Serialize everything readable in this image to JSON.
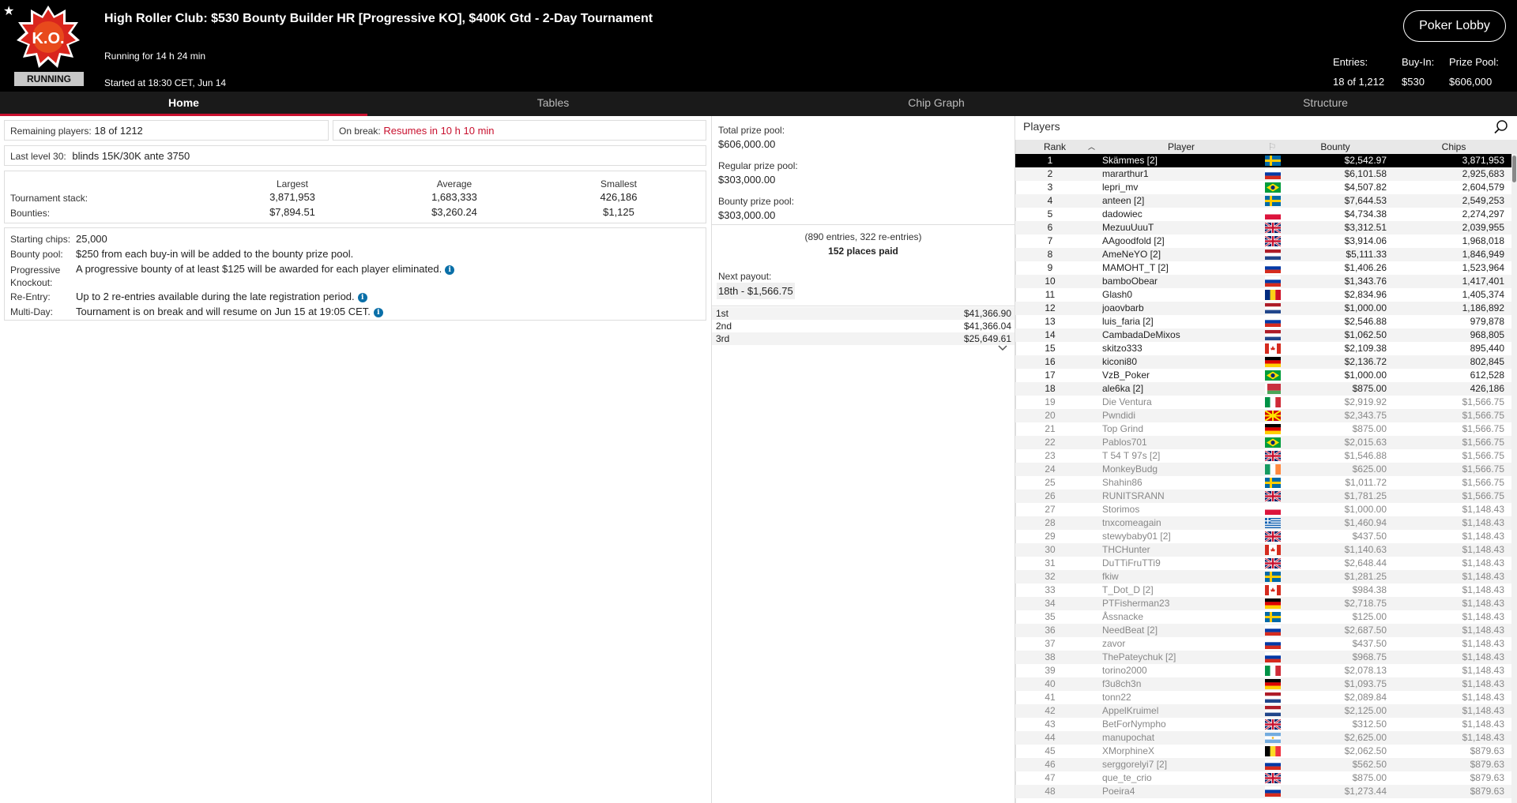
{
  "header": {
    "title": "High Roller Club: $530 Bounty Builder HR [Progressive KO], $400K Gtd - 2-Day Tournament",
    "running_for": "Running for 14 h 24 min",
    "started": "Started at 18:30 CET, Jun 14",
    "status_badge": "RUNNING",
    "logo_text": "K.O.",
    "lobby_button": "Poker Lobby",
    "entries_label": "Entries:",
    "entries_value": "18 of 1,212",
    "buyin_label": "Buy-In:",
    "buyin_value": "$530",
    "prizepool_label": "Prize Pool:",
    "prizepool_value": "$606,000"
  },
  "tabs": [
    "Home",
    "Tables",
    "Chip Graph",
    "Structure"
  ],
  "home": {
    "remaining_label": "Remaining players:",
    "remaining_value": "18 of 1212",
    "onbreak_label": "On break:",
    "onbreak_value": "Resumes in 10 h 10 min",
    "lastlevel_label": "Last level 30:",
    "lastlevel_value": "blinds 15K/30K ante 3750",
    "stack_headers": [
      "Largest",
      "Average",
      "Smallest"
    ],
    "stack_label": "Tournament stack:",
    "stack_values": [
      "3,871,953",
      "1,683,333",
      "426,186"
    ],
    "bounties_label": "Bounties:",
    "bounty_values": [
      "$7,894.51",
      "$3,260.24",
      "$1,125"
    ],
    "rules": [
      {
        "label": "Starting chips:",
        "text": "25,000"
      },
      {
        "label": "Bounty pool:",
        "text": "$250 from each buy-in will be added to the bounty prize pool."
      },
      {
        "label": "Progressive Knockout:",
        "text": "A progressive bounty of at least $125 will be awarded for each player eliminated."
      },
      {
        "label": "Re-Entry:",
        "text": "Up to 2 re-entries available during the late registration period."
      },
      {
        "label": "Multi-Day:",
        "text": "Tournament is on break and will resume on Jun 15 at 19:05 CET."
      }
    ]
  },
  "prize": {
    "total_label": "Total prize pool:",
    "total_value": "$606,000.00",
    "regular_label": "Regular prize pool:",
    "regular_value": "$303,000.00",
    "bounty_label": "Bounty prize pool:",
    "bounty_value": "$303,000.00",
    "entries_note": "(890 entries, 322 re-entries)",
    "places_paid": "152 places paid",
    "next_payout_label": "Next payout:",
    "next_payout_value": "18th - $1,566.75",
    "payouts": [
      {
        "place": "1st",
        "amount": "$41,366.90"
      },
      {
        "place": "2nd",
        "amount": "$41,366.04"
      },
      {
        "place": "3rd",
        "amount": "$25,649.61"
      }
    ]
  },
  "players": {
    "title": "Players",
    "columns": [
      "Rank",
      "Player",
      "Bounty",
      "Chips"
    ],
    "rows": [
      {
        "rank": "1",
        "name": "Skämmes [2]",
        "flag": "se",
        "bounty": "$2,542.97",
        "chips": "3,871,953"
      },
      {
        "rank": "2",
        "name": "mararthur1",
        "flag": "ru",
        "bounty": "$6,101.58",
        "chips": "2,925,683"
      },
      {
        "rank": "3",
        "name": "lepri_mv",
        "flag": "br",
        "bounty": "$4,507.82",
        "chips": "2,604,579"
      },
      {
        "rank": "4",
        "name": "anteen [2]",
        "flag": "se",
        "bounty": "$7,644.53",
        "chips": "2,549,253"
      },
      {
        "rank": "5",
        "name": "dadowiec",
        "flag": "pl",
        "bounty": "$4,734.38",
        "chips": "2,274,297"
      },
      {
        "rank": "6",
        "name": "MezuuUuuT",
        "flag": "gb",
        "bounty": "$3,312.51",
        "chips": "2,039,955"
      },
      {
        "rank": "7",
        "name": "AAgoodfold [2]",
        "flag": "gb",
        "bounty": "$3,914.06",
        "chips": "1,968,018"
      },
      {
        "rank": "8",
        "name": "AmeNeYO [2]",
        "flag": "nl",
        "bounty": "$5,111.33",
        "chips": "1,846,949"
      },
      {
        "rank": "9",
        "name": "MAMOHT_T [2]",
        "flag": "ru",
        "bounty": "$1,406.26",
        "chips": "1,523,964"
      },
      {
        "rank": "10",
        "name": "bamboObear",
        "flag": "ru",
        "bounty": "$1,343.76",
        "chips": "1,417,401"
      },
      {
        "rank": "11",
        "name": "Glash0",
        "flag": "ro",
        "bounty": "$2,834.96",
        "chips": "1,405,374"
      },
      {
        "rank": "12",
        "name": "joaovbarb",
        "flag": "nl",
        "bounty": "$1,000.00",
        "chips": "1,186,892"
      },
      {
        "rank": "13",
        "name": "luis_faria [2]",
        "flag": "ru",
        "bounty": "$2,546.88",
        "chips": "979,878"
      },
      {
        "rank": "14",
        "name": "CambadaDeMixos",
        "flag": "nl",
        "bounty": "$1,062.50",
        "chips": "968,805"
      },
      {
        "rank": "15",
        "name": "skitzo333",
        "flag": "ca",
        "bounty": "$2,109.38",
        "chips": "895,440"
      },
      {
        "rank": "16",
        "name": "kiconi80",
        "flag": "de",
        "bounty": "$2,136.72",
        "chips": "802,845"
      },
      {
        "rank": "17",
        "name": "VzB_Poker",
        "flag": "br",
        "bounty": "$1,000.00",
        "chips": "612,528"
      },
      {
        "rank": "18",
        "name": "ale6ka [2]",
        "flag": "by",
        "bounty": "$875.00",
        "chips": "426,186"
      },
      {
        "rank": "19",
        "name": "Die Ventura",
        "flag": "it",
        "bounty": "$2,919.92",
        "chips": "$1,566.75"
      },
      {
        "rank": "20",
        "name": "Pwndidi",
        "flag": "mk",
        "bounty": "$2,343.75",
        "chips": "$1,566.75"
      },
      {
        "rank": "21",
        "name": "Top Grind",
        "flag": "de",
        "bounty": "$875.00",
        "chips": "$1,566.75"
      },
      {
        "rank": "22",
        "name": "Pablos701",
        "flag": "br",
        "bounty": "$2,015.63",
        "chips": "$1,566.75"
      },
      {
        "rank": "23",
        "name": "T 54 T 97s [2]",
        "flag": "gb",
        "bounty": "$1,546.88",
        "chips": "$1,566.75"
      },
      {
        "rank": "24",
        "name": "MonkeyBudg",
        "flag": "ie",
        "bounty": "$625.00",
        "chips": "$1,566.75"
      },
      {
        "rank": "25",
        "name": "Shahin86",
        "flag": "se",
        "bounty": "$1,011.72",
        "chips": "$1,566.75"
      },
      {
        "rank": "26",
        "name": "RUNITSRANN",
        "flag": "gb",
        "bounty": "$1,781.25",
        "chips": "$1,566.75"
      },
      {
        "rank": "27",
        "name": "Storimos",
        "flag": "pl",
        "bounty": "$1,000.00",
        "chips": "$1,148.43"
      },
      {
        "rank": "28",
        "name": "tnxcomeagain",
        "flag": "gr",
        "bounty": "$1,460.94",
        "chips": "$1,148.43"
      },
      {
        "rank": "29",
        "name": "stewybaby01 [2]",
        "flag": "gb",
        "bounty": "$437.50",
        "chips": "$1,148.43"
      },
      {
        "rank": "30",
        "name": "THCHunter",
        "flag": "ca",
        "bounty": "$1,140.63",
        "chips": "$1,148.43"
      },
      {
        "rank": "31",
        "name": "DuTTiFruTTi9",
        "flag": "gb",
        "bounty": "$2,648.44",
        "chips": "$1,148.43"
      },
      {
        "rank": "32",
        "name": "fkiw",
        "flag": "se",
        "bounty": "$1,281.25",
        "chips": "$1,148.43"
      },
      {
        "rank": "33",
        "name": "T_Dot_D [2]",
        "flag": "ca",
        "bounty": "$984.38",
        "chips": "$1,148.43"
      },
      {
        "rank": "34",
        "name": "PTFisherman23",
        "flag": "de",
        "bounty": "$2,718.75",
        "chips": "$1,148.43"
      },
      {
        "rank": "35",
        "name": "Åssnacke",
        "flag": "se",
        "bounty": "$125.00",
        "chips": "$1,148.43"
      },
      {
        "rank": "36",
        "name": "NeedBeat [2]",
        "flag": "ru",
        "bounty": "$2,687.50",
        "chips": "$1,148.43"
      },
      {
        "rank": "37",
        "name": "zavor",
        "flag": "ru",
        "bounty": "$437.50",
        "chips": "$1,148.43"
      },
      {
        "rank": "38",
        "name": "ThePateychuk [2]",
        "flag": "ru",
        "bounty": "$968.75",
        "chips": "$1,148.43"
      },
      {
        "rank": "39",
        "name": "torino2000",
        "flag": "it",
        "bounty": "$2,078.13",
        "chips": "$1,148.43"
      },
      {
        "rank": "40",
        "name": "f3u8ch3n",
        "flag": "de",
        "bounty": "$1,093.75",
        "chips": "$1,148.43"
      },
      {
        "rank": "41",
        "name": "tonn22",
        "flag": "nl",
        "bounty": "$2,089.84",
        "chips": "$1,148.43"
      },
      {
        "rank": "42",
        "name": "AppelKruimel",
        "flag": "nl",
        "bounty": "$2,125.00",
        "chips": "$1,148.43"
      },
      {
        "rank": "43",
        "name": "BetForNympho",
        "flag": "gb",
        "bounty": "$312.50",
        "chips": "$1,148.43"
      },
      {
        "rank": "44",
        "name": "manupochat",
        "flag": "ar",
        "bounty": "$2,625.00",
        "chips": "$1,148.43"
      },
      {
        "rank": "45",
        "name": "XMorphineX",
        "flag": "be",
        "bounty": "$2,062.50",
        "chips": "$879.63"
      },
      {
        "rank": "46",
        "name": "serggorelyi7 [2]",
        "flag": "ru",
        "bounty": "$562.50",
        "chips": "$879.63"
      },
      {
        "rank": "47",
        "name": "que_te_crio",
        "flag": "gb",
        "bounty": "$875.00",
        "chips": "$879.63"
      },
      {
        "rank": "48",
        "name": "Poeira4",
        "flag": "ru",
        "bounty": "$1,273.44",
        "chips": "$879.63"
      }
    ]
  },
  "colors": {
    "accent": "#c8102e",
    "header_bg": "#000000",
    "selected_row": "#000000"
  }
}
